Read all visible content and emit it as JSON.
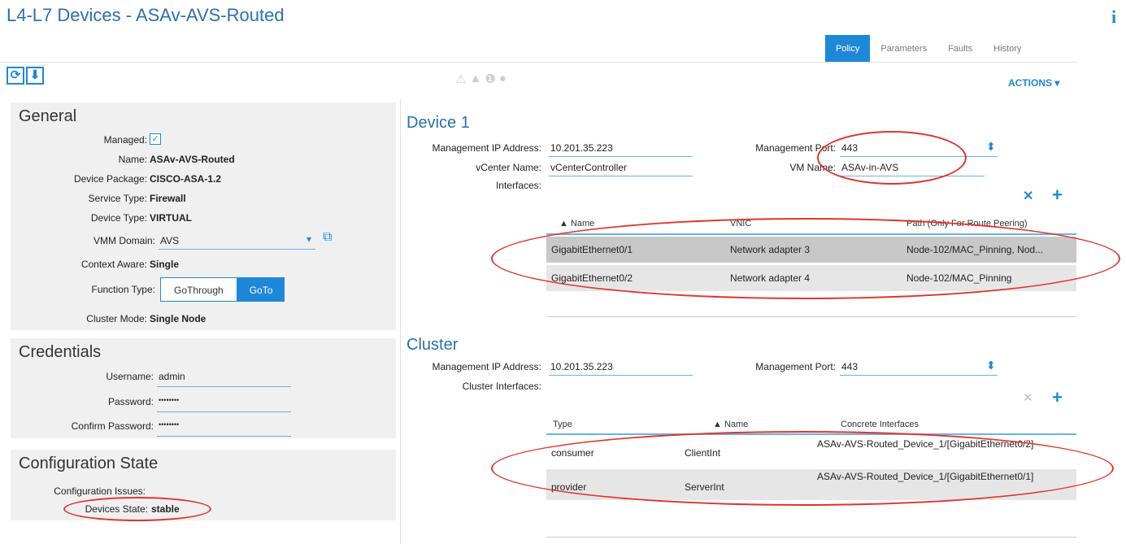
{
  "header": {
    "title": "L4-L7 Devices - ASAv-AVS-Routed",
    "info_icon": "i"
  },
  "tabs": [
    "Policy",
    "Parameters",
    "Faults",
    "History"
  ],
  "toolbar": {
    "refresh_glyph": "⟳",
    "download_glyph": "⬇",
    "fault_glyphs": [
      "⚠",
      "▲",
      "❶",
      "●"
    ],
    "actions_label": "ACTIONS ▾"
  },
  "general": {
    "title": "General",
    "managed_label": "Managed:",
    "name_label": "Name:",
    "name_value": "ASAv-AVS-Routed",
    "package_label": "Device Package:",
    "package_value": "CISCO-ASA-1.2",
    "service_label": "Service Type:",
    "service_value": "Firewall",
    "device_type_label": "Device Type:",
    "device_type_value": "VIRTUAL",
    "vmm_label": "VMM Domain:",
    "vmm_value": "AVS",
    "context_label": "Context Aware:",
    "context_value": "Single",
    "function_label": "Function Type:",
    "function_options": [
      "GoThrough",
      "GoTo"
    ],
    "cluster_mode_label": "Cluster Mode:",
    "cluster_mode_value": "Single Node"
  },
  "credentials": {
    "title": "Credentials",
    "username_label": "Username:",
    "username_value": "admin",
    "password_label": "Password:",
    "password_value": "••••••••",
    "confirm_label": "Confirm Password:",
    "confirm_value": "••••••••"
  },
  "config_state": {
    "title": "Configuration State",
    "issues_label": "Configuration Issues:",
    "state_label": "Devices State:",
    "state_value": "stable"
  },
  "device1": {
    "title": "Device 1",
    "mgmt_ip_label": "Management IP Address:",
    "mgmt_ip_value": "10.201.35.223",
    "mgmt_port_label": "Management Port:",
    "mgmt_port_value": "443",
    "vcenter_label": "vCenter Name:",
    "vcenter_value": "vCenterController",
    "vm_name_label": "VM Name:",
    "vm_name_value": "ASAv-in-AVS",
    "interfaces_label": "Interfaces:",
    "columns": [
      "▲ Name",
      "VNIC",
      "Path (Only For Route Peering)"
    ],
    "rows": [
      {
        "name": "GigabitEthernet0/1",
        "vnic": "Network adapter 3",
        "path": "Node-102/MAC_Pinning, Nod..."
      },
      {
        "name": "GigabitEthernet0/2",
        "vnic": "Network adapter 4",
        "path": "Node-102/MAC_Pinning"
      }
    ]
  },
  "cluster": {
    "title": "Cluster",
    "mgmt_ip_label": "Management IP Address:",
    "mgmt_ip_value": "10.201.35.223",
    "mgmt_port_label": "Management Port:",
    "mgmt_port_value": "443",
    "interfaces_label": "Cluster Interfaces:",
    "columns": [
      "Type",
      "▲ Name",
      "Concrete Interfaces"
    ],
    "rows": [
      {
        "type": "consumer",
        "name": "ClientInt",
        "concrete": "ASAv-AVS-Routed_Device_1/[GigabitEthernet0/2]"
      },
      {
        "type": "provider",
        "name": "ServerInt",
        "concrete": "ASAv-AVS-Routed_Device_1/[GigabitEthernet0/1]"
      }
    ]
  },
  "icons": {
    "close": "✕",
    "add": "+",
    "spinner": "⬍",
    "dropdown": "▾",
    "external": "⧉",
    "check": "✓"
  },
  "colors": {
    "accent": "#1e88d8",
    "annotation": "#e0342b",
    "panel_bg": "#f0f0f0"
  }
}
